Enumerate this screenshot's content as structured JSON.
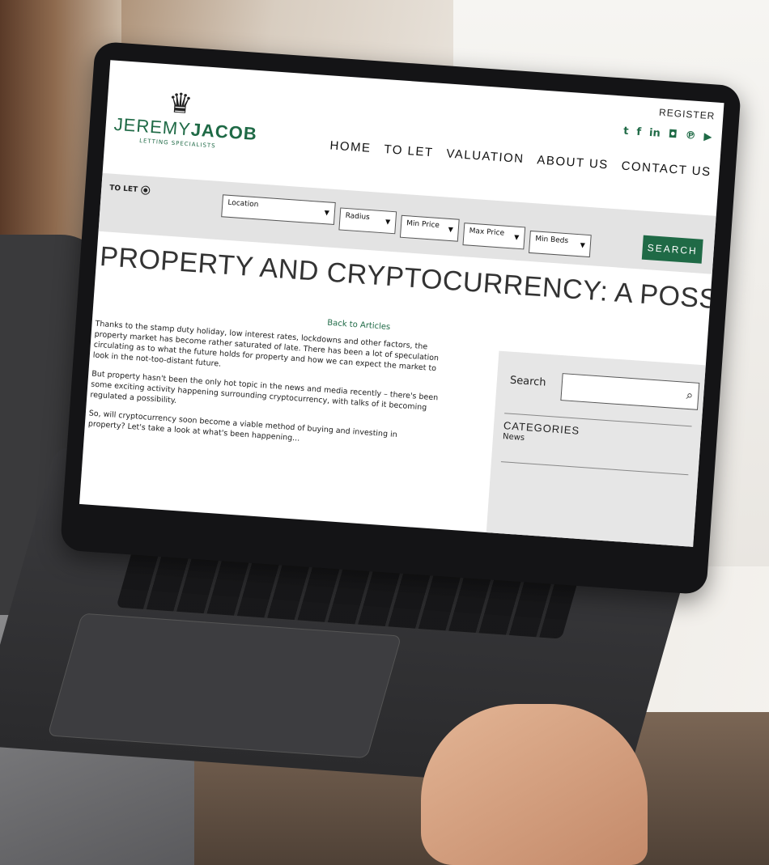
{
  "header": {
    "logo_first": "JEREMY",
    "logo_second": "JACOB",
    "logo_tagline": "LETTING SPECIALISTS",
    "register": "REGISTER",
    "social_icons": [
      "twitter-icon",
      "facebook-icon",
      "linkedin-icon",
      "instagram-icon",
      "pinterest-icon",
      "youtube-icon"
    ],
    "nav": [
      "HOME",
      "TO LET",
      "VALUATION",
      "ABOUT US",
      "CONTACT US"
    ]
  },
  "search": {
    "mode_label": "TO LET",
    "location": "Location",
    "radius": "Radius",
    "min_price": "Min Price",
    "max_price": "Max Price",
    "min_beds": "Min Beds",
    "button": "SEARCH"
  },
  "article": {
    "title": "PROPERTY AND CRYPTOCURRENCY: A POSSIBILITY?",
    "back_link": "Back to Articles",
    "paragraphs": [
      "Thanks to the stamp duty holiday, low interest rates, lockdowns and other factors, the property market has become rather saturated of late. There has been a lot of speculation circulating as to what the future holds for property and how we can expect the market to look in the not-too-distant future.",
      "But property hasn't been the only hot topic in the news and media recently – there's been some exciting activity happening surrounding cryptocurrency, with talks of it becoming regulated a possibility.",
      "So, will cryptocurrency soon become a viable method of buying and investing in property? Let's take a look at what's been happening..."
    ]
  },
  "sidebar": {
    "search_label": "Search",
    "categories_title": "CATEGORIES",
    "categories": [
      "News"
    ]
  },
  "colors": {
    "brand_green": "#1f6a46",
    "bar_gray": "#e3e3e3"
  }
}
